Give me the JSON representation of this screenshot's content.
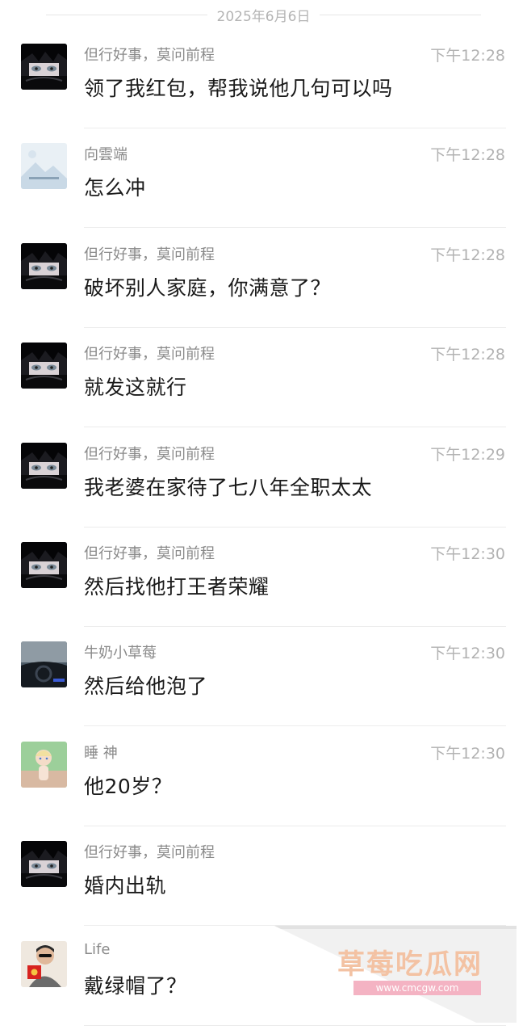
{
  "date_separator": "2025年6月6日",
  "messages": [
    {
      "sender": "但行好事，莫问前程",
      "time": "下午12:28",
      "text": "领了我红包，帮我说他几句可以吗",
      "avatar": "dark-hair-eyes-avatar"
    },
    {
      "sender": "向雲端",
      "time": "下午12:28",
      "text": "怎么冲",
      "avatar": "light-blue-landscape-avatar"
    },
    {
      "sender": "但行好事，莫问前程",
      "time": "下午12:28",
      "text": "破坏别人家庭，你满意了？",
      "avatar": "dark-hair-eyes-avatar"
    },
    {
      "sender": "但行好事，莫问前程",
      "time": "下午12:28",
      "text": "就发这就行",
      "avatar": "dark-hair-eyes-avatar"
    },
    {
      "sender": "但行好事，莫问前程",
      "time": "下午12:29",
      "text": "我老婆在家待了七八年全职太太",
      "avatar": "dark-hair-eyes-avatar"
    },
    {
      "sender": "但行好事，莫问前程",
      "time": "下午12:30",
      "text": "然后找他打王者荣耀",
      "avatar": "dark-hair-eyes-avatar"
    },
    {
      "sender": "牛奶小草莓",
      "time": "下午12:30",
      "text": "然后给他泡了",
      "avatar": "car-interior-avatar"
    },
    {
      "sender": "睡 神",
      "time": "下午12:30",
      "text": "他20岁？",
      "avatar": "cartoon-child-avatar"
    },
    {
      "sender": "但行好事，莫问前程",
      "time": "",
      "text": "婚内出轨",
      "avatar": "dark-hair-eyes-avatar"
    },
    {
      "sender": "Life",
      "time": "",
      "text": "戴绿帽了？",
      "avatar": "child-red-envelope-avatar"
    }
  ],
  "watermark": {
    "title": "草莓吃瓜网",
    "url": "www.cmcgw.com"
  }
}
